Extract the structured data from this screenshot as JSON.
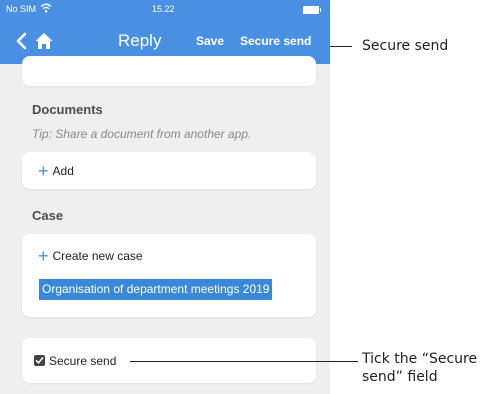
{
  "status_bar": {
    "carrier": "No SIM",
    "time": "15.22"
  },
  "nav": {
    "title": "Reply",
    "save_label": "Save",
    "secure_send_label": "Secure send"
  },
  "documents": {
    "title": "Documents",
    "tip": "Tip: Share a document from another app.",
    "add_label": "Add"
  },
  "case": {
    "title": "Case",
    "create_label": "Create new case",
    "selected_case": "Organisation of department meetings 2019"
  },
  "secure": {
    "checkbox_label": "Secure send",
    "checked": true
  },
  "annotations": {
    "top": "Secure send",
    "bottom_line1": "Tick the “Secure",
    "bottom_line2": "send” field"
  },
  "colors": {
    "accent": "#4a90e2",
    "selection": "#3a89d9",
    "background": "#efefef"
  }
}
